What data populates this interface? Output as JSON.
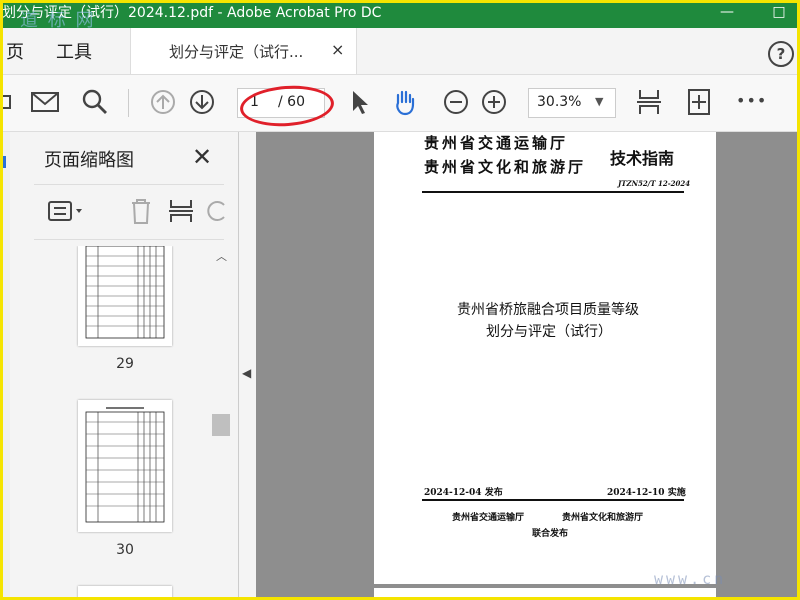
{
  "window": {
    "title": "划分与评定（试行）2024.12.pdf - Adobe Acrobat Pro DC",
    "watermark": "道 标 网",
    "minimize": "—",
    "maximize": "□"
  },
  "menubar": {
    "items": [
      "页",
      "工具"
    ]
  },
  "tab": {
    "label": "划分与评定（试行...",
    "close": "×"
  },
  "help": {
    "label": "?"
  },
  "toolbar": {
    "page_current": "1",
    "page_total": "/ 60",
    "zoom": "30.3%",
    "more": "•••"
  },
  "panel": {
    "title": "页面缩略图",
    "close": "✕",
    "thumbnails": [
      {
        "page": "29"
      },
      {
        "page": "30"
      }
    ]
  },
  "document": {
    "issuer1": "贵州省交通运输厅",
    "issuer2": "贵州省文化和旅游厅",
    "doc_type": "技术指南",
    "doc_code": "JTZN52/T 12-2024",
    "title_line1": "贵州省桥旅融合项目质量等级",
    "title_line2": "划分与评定（试行）",
    "publish_date": "2024-12-04  发布",
    "implement_date": "2024-12-10  实施",
    "footer_issuer1": "贵州省交通运输厅",
    "footer_issuer2": "贵州省文化和旅游厅",
    "footer_joint": "联合发布"
  },
  "corner_watermark": "www.cn",
  "colors": {
    "titlebar": "#1f8a3d",
    "highlight_oval": "#e0202a",
    "frame": "#f5e400",
    "hand_tool": "#2a6fd6"
  }
}
